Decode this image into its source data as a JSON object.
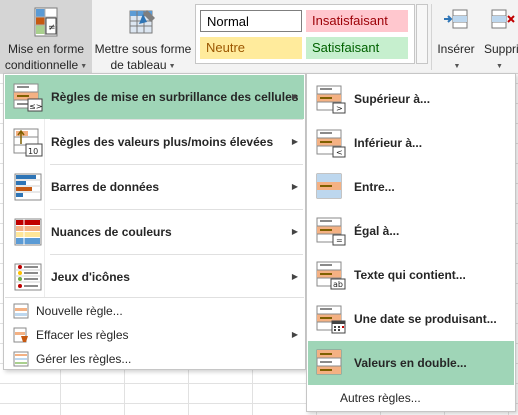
{
  "ribbon": {
    "conditional_format": {
      "line1": "Mise en forme",
      "line2": "conditionnelle",
      "icon": "conditional-format-icon"
    },
    "format_as_table": {
      "line1": "Mettre sous forme",
      "line2": "de tableau",
      "icon": "format-table-icon"
    },
    "cell_styles": {
      "normal": "Normal",
      "insatisfaisant": "Insatisfaisant",
      "neutre": "Neutre",
      "satisfaisant": "Satisfaisant"
    },
    "insert": {
      "label": "Insérer",
      "icon": "insert-cells-icon"
    },
    "delete": {
      "label": "Supprim",
      "icon": "delete-cells-icon"
    }
  },
  "menu": {
    "items": [
      {
        "label": "Règles de mise en surbrillance des cellules",
        "icon": "highlight-rules-icon",
        "highlighted": true,
        "has_submenu": true
      },
      {
        "label": "Règles des valeurs plus/moins élevées",
        "icon": "top-bottom-rules-icon",
        "has_submenu": true
      },
      {
        "label": "Barres de données",
        "icon": "data-bars-icon",
        "has_submenu": true
      },
      {
        "label": "Nuances de couleurs",
        "icon": "color-scales-icon",
        "has_submenu": true
      },
      {
        "label": "Jeux d'icônes",
        "icon": "icon-sets-icon",
        "has_submenu": true
      }
    ],
    "small_items": [
      {
        "label": "Nouvelle règle...",
        "icon": "new-rule-icon"
      },
      {
        "label": "Effacer les règles",
        "icon": "clear-rules-icon",
        "has_submenu": true
      },
      {
        "label": "Gérer les règles...",
        "icon": "manage-rules-icon"
      }
    ]
  },
  "submenu": {
    "items": [
      {
        "label": "Supérieur à...",
        "icon": "greater-than-icon"
      },
      {
        "label": "Inférieur à...",
        "icon": "less-than-icon"
      },
      {
        "label": "Entre...",
        "icon": "between-icon"
      },
      {
        "label": "Égal à...",
        "icon": "equal-to-icon"
      },
      {
        "label": "Texte qui contient...",
        "icon": "text-contains-icon"
      },
      {
        "label": "Une date se produisant...",
        "icon": "date-occurring-icon"
      },
      {
        "label": "Valeurs en double...",
        "icon": "duplicate-values-icon",
        "highlighted": true
      }
    ],
    "more": "Autres règles..."
  },
  "colors": {
    "highlight": "#9fd5b7",
    "ribbon_bg": "#f3f3f3",
    "pressed_button": "#d5d5d5"
  }
}
